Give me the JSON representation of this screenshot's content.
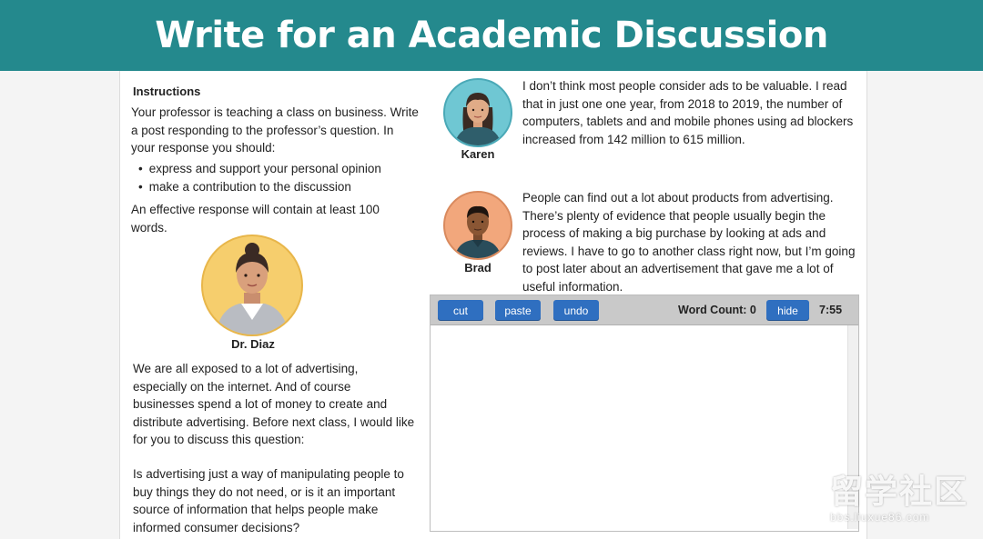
{
  "banner": {
    "title": "Write for an Academic Discussion"
  },
  "instructions": {
    "heading": "Instructions",
    "text": "Your professor is teaching a class on business. Write a post responding to the professor’s question. In your response you should:",
    "bullets": [
      "express and support your personal opinion",
      "make a contribution to the discussion"
    ],
    "effective": "An effective response will contain at least 100 words."
  },
  "professor": {
    "name": "Dr. Diaz",
    "post": "We are all exposed to a lot of advertising, especially on the internet.  And of course businesses spend a lot of money to create and distribute advertising.  Before next class, I would like for you to discuss this question:",
    "question": "Is advertising just a way of manipulating people to buy things they do not need, or is it an important source of information that helps people make informed consumer decisions?"
  },
  "students": [
    {
      "name": "Karen",
      "post": "I don’t think most people consider ads to be valuable.  I read that in just one one year, from 2018 to 2019, the number of computers, tablets and  and mobile phones using ad blockers increased from 142 million to 615 million."
    },
    {
      "name": "Brad",
      "post": "People can find out a lot about products from advertising.  There’s plenty of evidence that people usually begin the process of making a big purchase by looking at ads and reviews.  I have to go to another class right now, but I’m going to post later about an advertisement that gave me a lot of useful information."
    }
  ],
  "editor": {
    "cut_label": "cut",
    "paste_label": "paste",
    "undo_label": "undo",
    "word_count_label": "Word Count: 0",
    "hide_label": "hide",
    "timer": "7:55",
    "value": ""
  },
  "watermark": {
    "big": "留学社区",
    "small": "bbs.liuxue86.com"
  },
  "colors": {
    "banner": "#24898d",
    "button": "#2f6fc0"
  }
}
